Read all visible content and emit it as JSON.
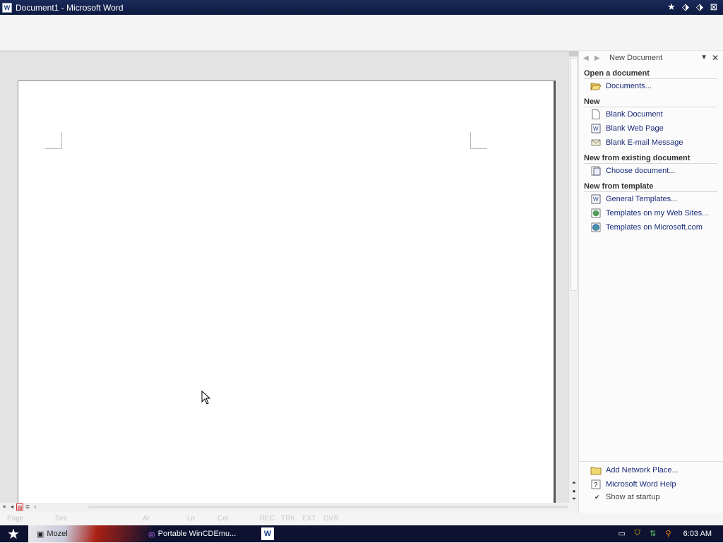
{
  "window": {
    "title": "Document1 - Microsoft Word",
    "app_icon": "W"
  },
  "title_buttons": [
    "★",
    "⬗",
    "⬗",
    "⊠"
  ],
  "task_pane": {
    "title": "New Document",
    "back_icon": "◀",
    "forward_icon": "▶",
    "dropdown_icon": "▼",
    "close_icon": "✕",
    "sections": [
      {
        "heading": "Open a document",
        "items": [
          {
            "label": "Documents...",
            "icon": "folder-open-icon"
          }
        ]
      },
      {
        "heading": "New",
        "items": [
          {
            "label": "Blank Document",
            "icon": "blank-document-icon"
          },
          {
            "label": "Blank Web Page",
            "icon": "web-page-icon"
          },
          {
            "label": "Blank E-mail Message",
            "icon": "email-icon"
          }
        ]
      },
      {
        "heading": "New from existing document",
        "items": [
          {
            "label": "Choose document...",
            "icon": "choose-document-icon"
          }
        ]
      },
      {
        "heading": "New from template",
        "items": [
          {
            "label": "General Templates...",
            "icon": "template-icon"
          },
          {
            "label": "Templates on my Web Sites...",
            "icon": "web-templates-icon"
          },
          {
            "label": "Templates on Microsoft.com",
            "icon": "globe-icon"
          }
        ]
      }
    ],
    "bottom_links": [
      {
        "label": "Add Network Place...",
        "icon": "network-folder-icon"
      },
      {
        "label": "Microsoft Word Help",
        "icon": "help-icon"
      }
    ],
    "show_at_startup": {
      "label": "Show at startup",
      "checked": true
    }
  },
  "statusbar": {
    "page": "Page",
    "sec": "Sec",
    "at": "At",
    "ln": "Ln",
    "col": "Col",
    "rec": "REC",
    "trk": "TRK",
    "ext": "EXT",
    "ovr": "OVR"
  },
  "taskbar": {
    "start_icon": "★",
    "items": [
      {
        "label": "Mozel",
        "icon": "explorer-icon"
      },
      {
        "label": "Portable WinCDEmu...",
        "icon": "cd-icon"
      },
      {
        "label": "",
        "icon": "word-icon"
      }
    ],
    "clock": "6:03 AM"
  }
}
